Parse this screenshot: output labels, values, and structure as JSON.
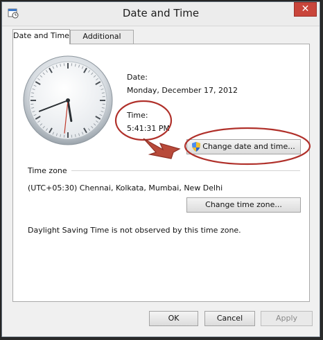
{
  "window": {
    "title": "Date and Time"
  },
  "tabs": [
    {
      "label": "Date and Time"
    },
    {
      "label": "Additional Clocks"
    }
  ],
  "date": {
    "label": "Date:",
    "value": "Monday, December 17, 2012"
  },
  "time": {
    "label": "Time:",
    "value": "5:41:31 PM"
  },
  "buttons": {
    "change_date_time": "Change date and time...",
    "change_time_zone": "Change time zone...",
    "ok": "OK",
    "cancel": "Cancel",
    "apply": "Apply"
  },
  "time_zone": {
    "section_label": "Time zone",
    "value": "(UTC+05:30) Chennai, Kolkata, Mumbai, New Delhi"
  },
  "dst_note": "Daylight Saving Time is not observed by this time zone.",
  "clock": {
    "hour": 5,
    "minute": 41,
    "second": 31
  },
  "colors": {
    "annotation_red": "#b0302a"
  },
  "icons": {
    "app": "calendar-clock-icon",
    "close": "close-icon",
    "shield": "uac-shield-icon"
  }
}
